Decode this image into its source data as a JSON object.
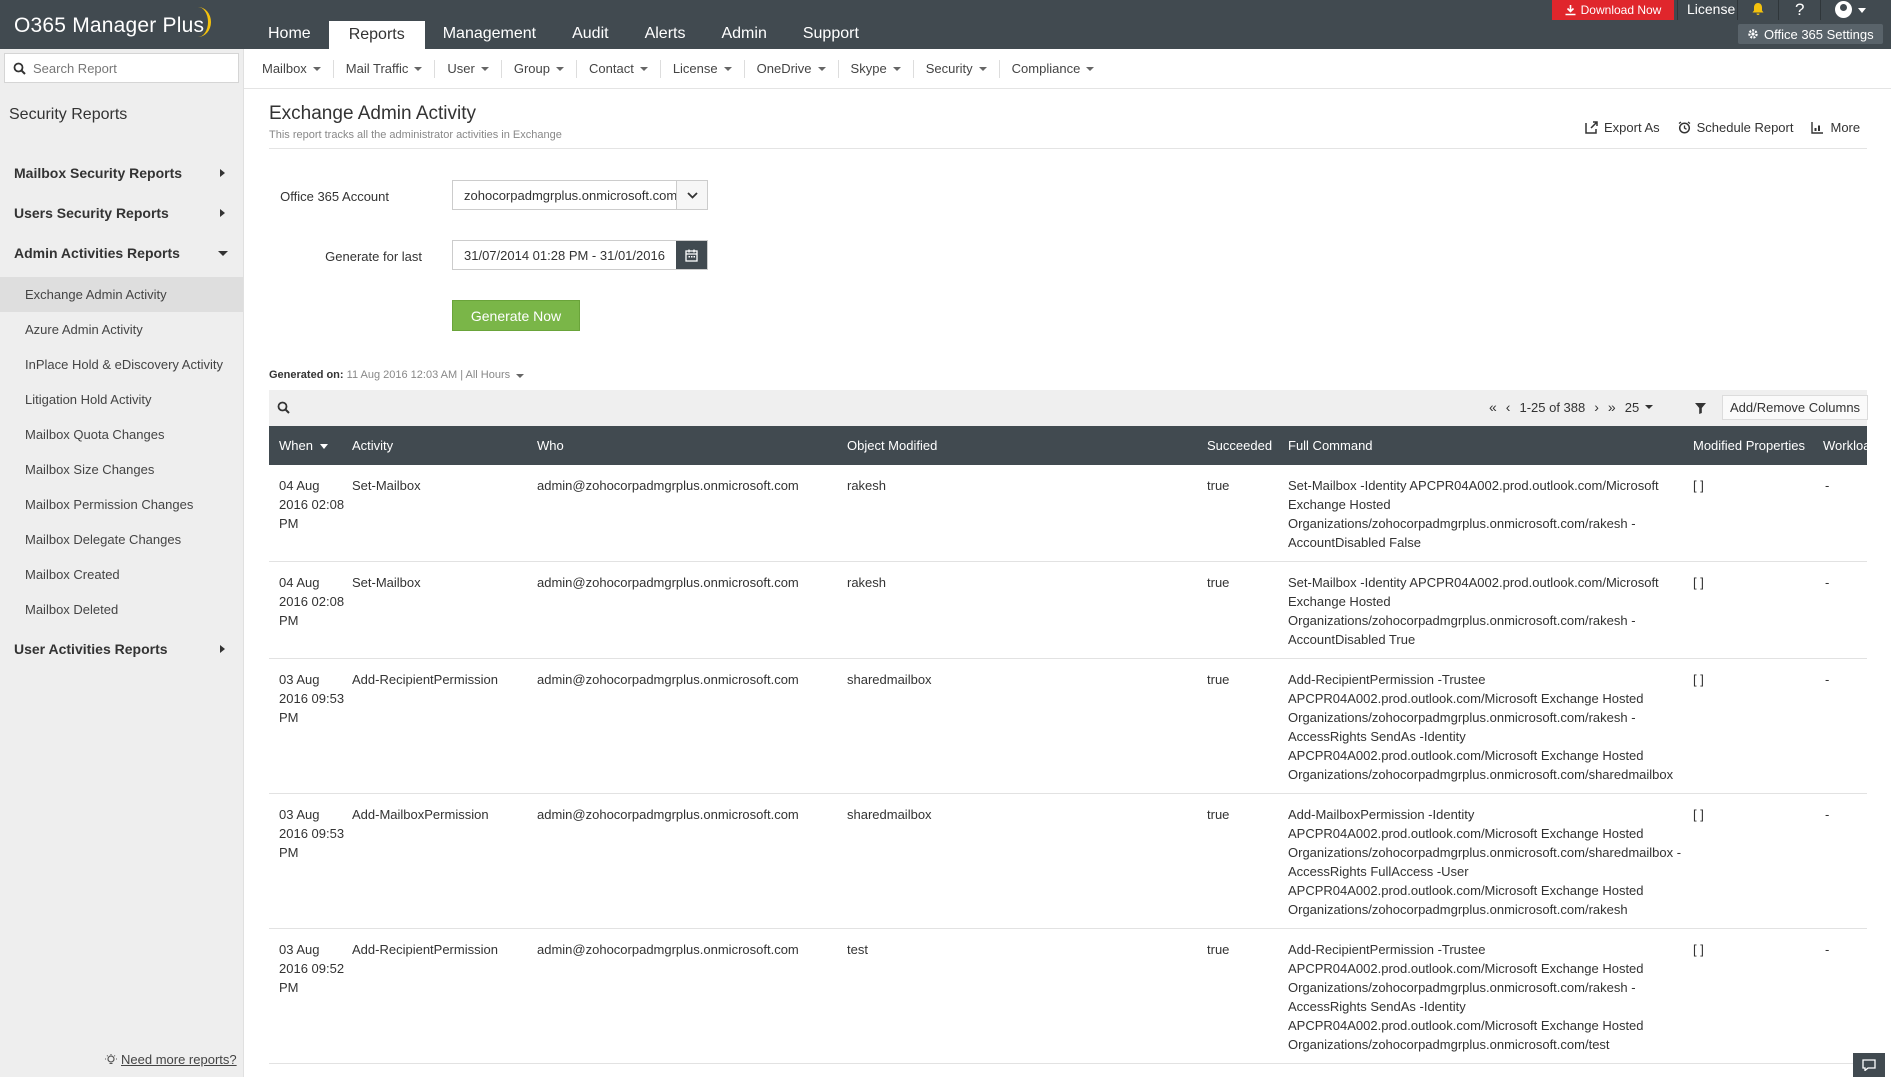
{
  "app": {
    "logo": "O365 Manager Plus",
    "nav": [
      "Home",
      "Reports",
      "Management",
      "Audit",
      "Alerts",
      "Admin",
      "Support"
    ],
    "active_nav": "Reports",
    "download_label": "Download Now",
    "license_label": "License",
    "help_label": "?",
    "settings_label": "Office 365 Settings"
  },
  "sidebar": {
    "search_placeholder": "Search Report",
    "title": "Security Reports",
    "sections": [
      {
        "label": "Mailbox Security Reports",
        "expanded": false
      },
      {
        "label": "Users Security Reports",
        "expanded": false
      },
      {
        "label": "Admin Activities Reports",
        "expanded": true
      },
      {
        "label": "User Activities Reports",
        "expanded": false
      }
    ],
    "items": [
      "Exchange Admin Activity",
      "Azure Admin Activity",
      "InPlace Hold & eDiscovery Activity",
      "Litigation Hold Activity",
      "Mailbox Quota Changes",
      "Mailbox Size Changes",
      "Mailbox Permission Changes",
      "Mailbox Delegate Changes",
      "Mailbox Created",
      "Mailbox Deleted"
    ],
    "active_item": "Exchange Admin Activity",
    "need_more": "Need more reports?"
  },
  "subnav": [
    "Mailbox",
    "Mail Traffic",
    "User",
    "Group",
    "Contact",
    "License",
    "OneDrive",
    "Skype",
    "Security",
    "Compliance"
  ],
  "page": {
    "title": "Exchange Admin Activity",
    "subtitle": "This report tracks all the administrator activities in Exchange",
    "actions": [
      "Export As",
      "Schedule Report",
      "More"
    ]
  },
  "form": {
    "account_label": "Office 365 Account",
    "account_value": "zohocorpadmgrplus.onmicrosoft.com",
    "period_label": "Generate for last",
    "period_value": "31/07/2014 01:28 PM - 31/01/2016",
    "generate_label": "Generate Now"
  },
  "generated": {
    "label": "Generated on:",
    "value": "11 Aug 2016 12:03 AM",
    "sep": "|",
    "hours": "All Hours"
  },
  "table": {
    "pager_text": "1-25 of 388",
    "page_size": "25",
    "add_columns": "Add/Remove Columns",
    "columns": [
      "When",
      "Activity",
      "Who",
      "Object Modified",
      "Succeeded",
      "Full Command",
      "Modified Properties",
      "Workload"
    ],
    "rows": [
      {
        "when": "04 Aug 2016 02:08 PM",
        "activity": "Set-Mailbox",
        "who": "admin@zohocorpadmgrplus.onmicrosoft.com",
        "object": "rakesh",
        "succeeded": "true",
        "command": "Set-Mailbox -Identity APCPR04A002.prod.outlook.com/Microsoft Exchange Hosted Organizations/zohocorpadmgrplus.onmicrosoft.com/rakesh -AccountDisabled False",
        "props": "[ ]",
        "workload": "-"
      },
      {
        "when": "04 Aug 2016 02:08 PM",
        "activity": "Set-Mailbox",
        "who": "admin@zohocorpadmgrplus.onmicrosoft.com",
        "object": "rakesh",
        "succeeded": "true",
        "command": "Set-Mailbox -Identity APCPR04A002.prod.outlook.com/Microsoft Exchange Hosted Organizations/zohocorpadmgrplus.onmicrosoft.com/rakesh -AccountDisabled True",
        "props": "[ ]",
        "workload": "-"
      },
      {
        "when": "03 Aug 2016 09:53 PM",
        "activity": "Add-RecipientPermission",
        "who": "admin@zohocorpadmgrplus.onmicrosoft.com",
        "object": "sharedmailbox",
        "succeeded": "true",
        "command": "Add-RecipientPermission -Trustee APCPR04A002.prod.outlook.com/Microsoft Exchange Hosted Organizations/zohocorpadmgrplus.onmicrosoft.com/rakesh -AccessRights SendAs -Identity APCPR04A002.prod.outlook.com/Microsoft Exchange Hosted Organizations/zohocorpadmgrplus.onmicrosoft.com/sharedmailbox",
        "props": "[ ]",
        "workload": "-"
      },
      {
        "when": "03 Aug 2016 09:53 PM",
        "activity": "Add-MailboxPermission",
        "who": "admin@zohocorpadmgrplus.onmicrosoft.com",
        "object": "sharedmailbox",
        "succeeded": "true",
        "command": "Add-MailboxPermission -Identity APCPR04A002.prod.outlook.com/Microsoft Exchange Hosted Organizations/zohocorpadmgrplus.onmicrosoft.com/sharedmailbox -AccessRights FullAccess -User APCPR04A002.prod.outlook.com/Microsoft Exchange Hosted Organizations/zohocorpadmgrplus.onmicrosoft.com/rakesh",
        "props": "[ ]",
        "workload": "-"
      },
      {
        "when": "03 Aug 2016 09:52 PM",
        "activity": "Add-RecipientPermission",
        "who": "admin@zohocorpadmgrplus.onmicrosoft.com",
        "object": "test",
        "succeeded": "true",
        "command": "Add-RecipientPermission -Trustee APCPR04A002.prod.outlook.com/Microsoft Exchange Hosted Organizations/zohocorpadmgrplus.onmicrosoft.com/rakesh -AccessRights SendAs -Identity APCPR04A002.prod.outlook.com/Microsoft Exchange Hosted Organizations/zohocorpadmgrplus.onmicrosoft.com/test",
        "props": "[ ]",
        "workload": "-"
      }
    ]
  }
}
